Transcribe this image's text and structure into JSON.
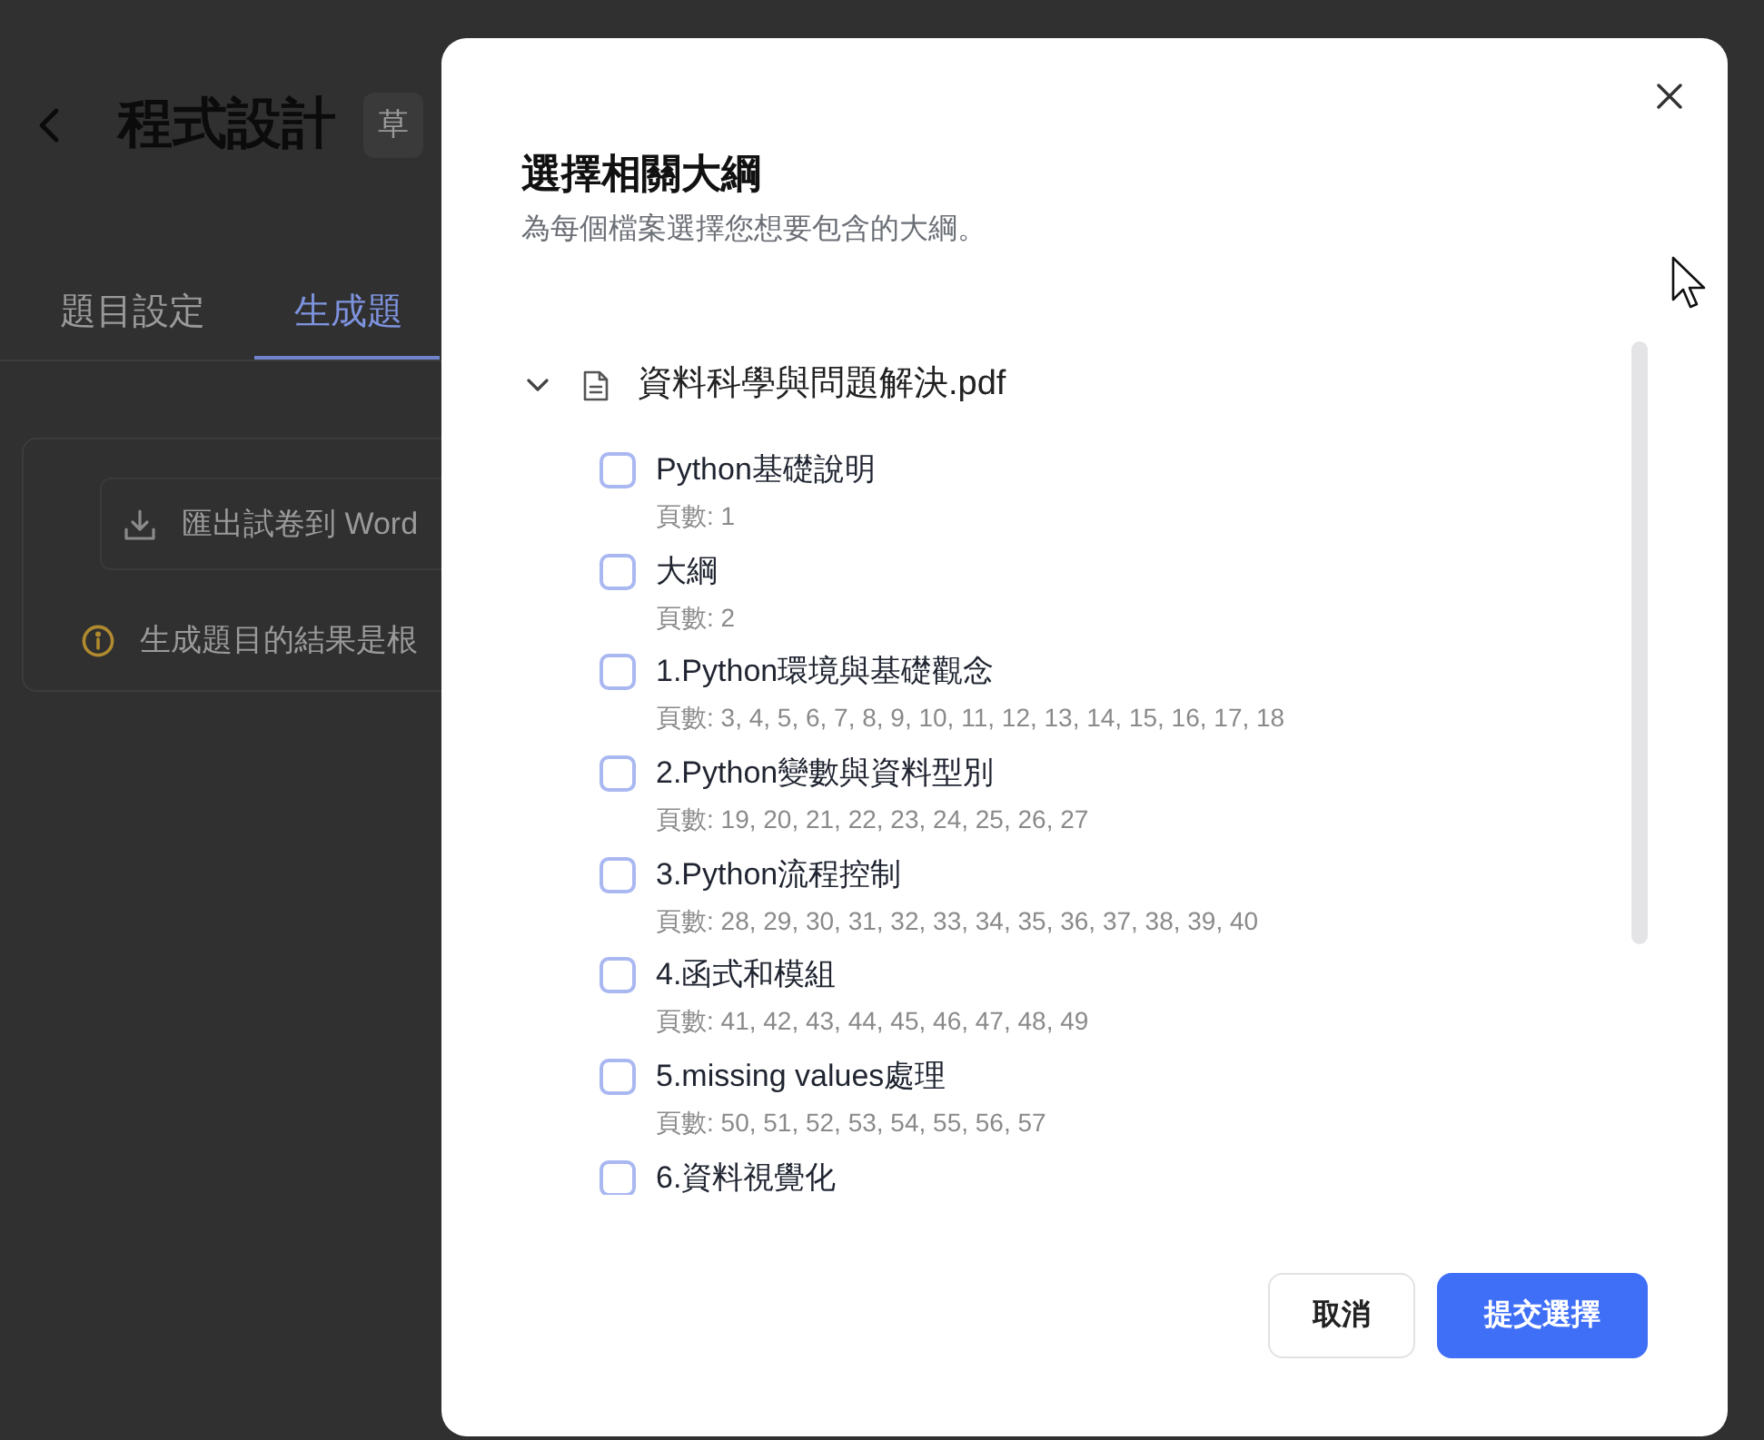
{
  "page": {
    "title": "程式設計",
    "badge": "草",
    "tabs": [
      {
        "label": "題目設定",
        "selected": false
      },
      {
        "label": "生成題",
        "selected": true
      }
    ],
    "export_button": "匯出試卷到 Word",
    "notice": "生成題目的結果是根"
  },
  "dialog": {
    "title": "選擇相關大綱",
    "subtitle": "為每個檔案選擇您想要包含的大綱。",
    "files": [
      {
        "name": "資料科學與問題解決.pdf",
        "expanded": true,
        "outlines": [
          {
            "title": "Python基礎說明",
            "pages": "頁數: 1",
            "checked": false
          },
          {
            "title": "大綱",
            "pages": "頁數: 2",
            "checked": false
          },
          {
            "title": "1.Python環境與基礎觀念",
            "pages": "頁數: 3, 4, 5, 6, 7, 8, 9, 10, 11, 12, 13, 14, 15, 16, 17, 18",
            "checked": false
          },
          {
            "title": "2.Python變數與資料型別",
            "pages": "頁數: 19, 20, 21, 22, 23, 24, 25, 26, 27",
            "checked": false
          },
          {
            "title": "3.Python流程控制",
            "pages": "頁數: 28, 29, 30, 31, 32, 33, 34, 35, 36, 37, 38, 39, 40",
            "checked": false
          },
          {
            "title": "4.函式和模組",
            "pages": "頁數: 41, 42, 43, 44, 45, 46, 47, 48, 49",
            "checked": false
          },
          {
            "title": "5.missing values處理",
            "pages": "頁數: 50, 51, 52, 53, 54, 55, 56, 57",
            "checked": false
          },
          {
            "title": "6.資料視覺化",
            "checked": false
          }
        ]
      }
    ],
    "buttons": [
      {
        "label": "取消",
        "kind": "secondary"
      },
      {
        "label": "提交選擇",
        "kind": "primary"
      }
    ]
  }
}
